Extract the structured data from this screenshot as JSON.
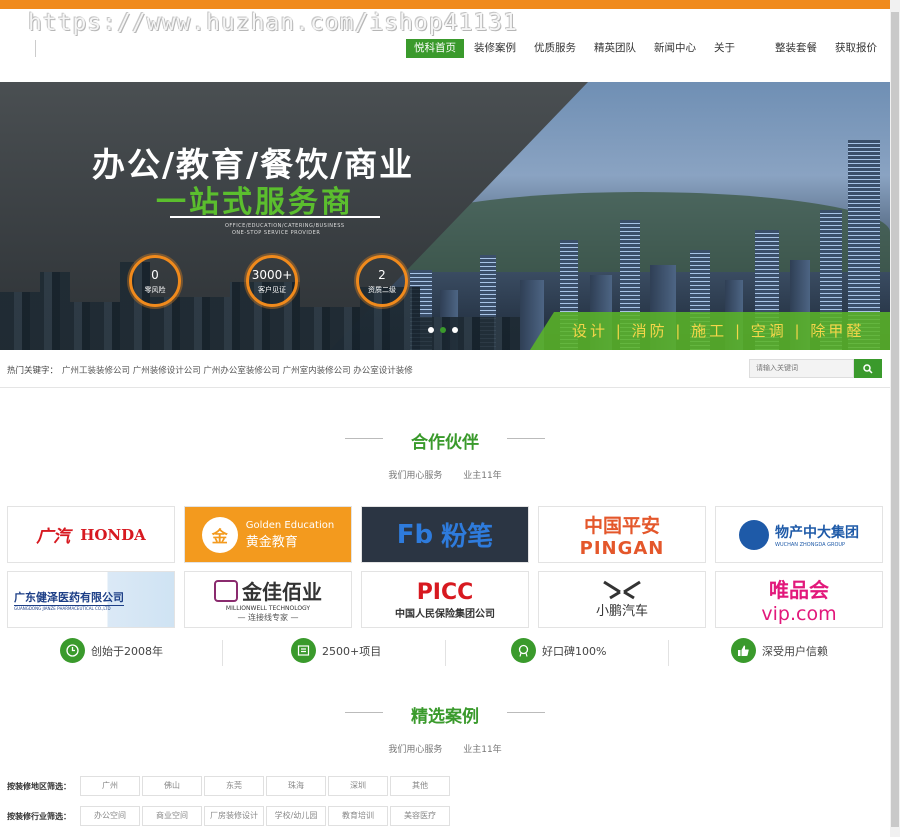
{
  "watermark": "https://www.huzhan.com/ishop41131",
  "nav": {
    "items": [
      "悦科首页",
      "装修案例",
      "优质服务",
      "精英团队",
      "新闻中心",
      "关于"
    ],
    "right_items": [
      "整装套餐",
      "获取报价"
    ]
  },
  "banner": {
    "title": "办公/教育/餐饮/商业",
    "subtitle": "一站式服务商",
    "en_line1": "OFFICE/EDUCATION/CATERING/BUSINESS",
    "en_line2": "ONE-STOP SERVICE PROVIDER",
    "stats": [
      {
        "num": "0",
        "label": "零风险"
      },
      {
        "num": "3000+",
        "label": "客户见证"
      },
      {
        "num": "2",
        "label": "资质二级"
      }
    ],
    "strip_text": "设计 | 消防 | 施工 | 空调 | 除甲醛"
  },
  "keywords": {
    "label": "热门关键字：",
    "links": "广州工装装修公司 广州装修设计公司 广州办公室装修公司 广州室内装修公司 办公室设计装修"
  },
  "search": {
    "placeholder": "请输入关键词"
  },
  "partners": {
    "title": "合作伙伴",
    "sub1": "我们用心服务",
    "sub2": "业主11年",
    "logos": [
      {
        "a": "广汽",
        "b": "HONDA"
      },
      {
        "a": "Golden Education",
        "b": "黄金教育"
      },
      {
        "a": "Fb",
        "b": "粉笔"
      },
      {
        "a": "中国平安",
        "b": "PINGAN"
      },
      {
        "a": "物产中大集团",
        "b": "WUCHAN ZHONGDA GROUP"
      },
      {
        "a": "广东健泽医药有限公司",
        "b": "GUANGDONG JIANZE PHARMACEUTICAL CO.,LTD"
      },
      {
        "a": "金佳佰业",
        "b": "MILLIONWELL TECHNOLOGY",
        "c": "— 连接线专家 —"
      },
      {
        "a": "PICC",
        "b": "中国人民保险集团公司"
      },
      {
        "a": "小鹏汽车",
        "b": ""
      },
      {
        "a": "唯品会",
        "b": "vip.com"
      }
    ]
  },
  "features": [
    {
      "text": "创始于2008年",
      "icon": "clock-icon"
    },
    {
      "text": "2500+项目",
      "icon": "list-icon"
    },
    {
      "text": "好口碑100%",
      "icon": "medal-icon"
    },
    {
      "text": "深受用户信赖",
      "icon": "thumbs-up-icon"
    }
  ],
  "cases": {
    "title": "精选案例",
    "sub1": "我们用心服务",
    "sub2": "业主11年",
    "region_label": "按装修地区筛选：",
    "regions": [
      "广州",
      "佛山",
      "东莞",
      "珠海",
      "深圳",
      "其他"
    ],
    "industry_label": "按装修行业筛选：",
    "industries": [
      "办公空间",
      "商业空间",
      "厂房装修设计",
      "学校/幼儿园",
      "教育培训",
      "美容医疗"
    ]
  },
  "colors": {
    "accent": "#3a9a2c",
    "orange": "#f08a1c"
  }
}
